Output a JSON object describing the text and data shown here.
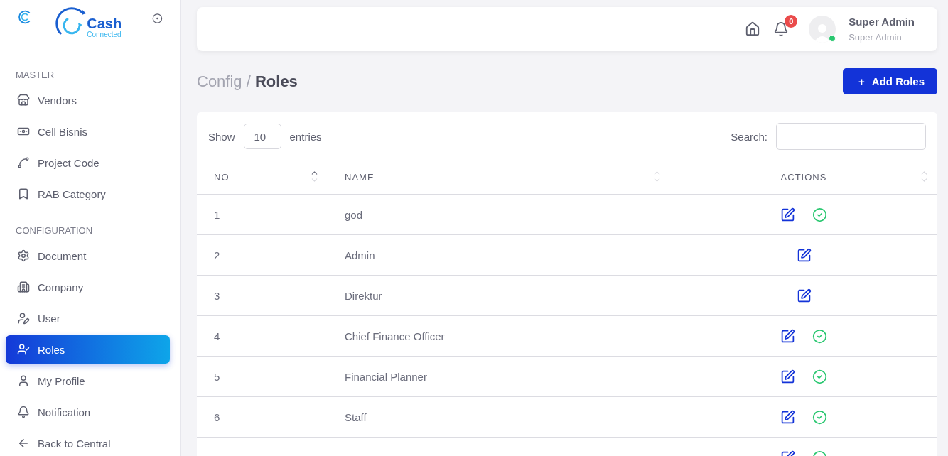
{
  "logo": {
    "word": "Cash",
    "tagline": "Connected"
  },
  "sidebar": {
    "sections": [
      {
        "title": "MASTER",
        "items": [
          {
            "label": "Vendors",
            "selected": false
          },
          {
            "label": "Cell Bisnis",
            "selected": false
          },
          {
            "label": "Project Code",
            "selected": false
          },
          {
            "label": "RAB Category",
            "selected": false
          }
        ]
      },
      {
        "title": "CONFIGURATION",
        "items": [
          {
            "label": "Document",
            "selected": false
          },
          {
            "label": "Company",
            "selected": false
          },
          {
            "label": "User",
            "selected": false
          },
          {
            "label": "Roles",
            "selected": true
          },
          {
            "label": "My Profile",
            "selected": false
          },
          {
            "label": "Notification",
            "selected": false
          },
          {
            "label": "Back to Central",
            "selected": false
          }
        ]
      }
    ]
  },
  "header": {
    "notification_count": "0",
    "user": {
      "name": "Super Admin",
      "role": "Super Admin",
      "online": true
    }
  },
  "breadcrumb": {
    "parent": "Config / ",
    "current": "Roles"
  },
  "add_button": {
    "icon": "+",
    "label": "Add Roles"
  },
  "table": {
    "show_label": "Show",
    "page_size": "10",
    "entries_label": "entries",
    "search_label": "Search:",
    "columns": [
      {
        "label": "NO",
        "sorted": true
      },
      {
        "label": "NAME",
        "sorted": false
      },
      {
        "label": "ACTIONS",
        "sorted": false
      }
    ],
    "rows": [
      {
        "no": "1",
        "name": "god",
        "approvable": true
      },
      {
        "no": "2",
        "name": "Admin",
        "approvable": false
      },
      {
        "no": "3",
        "name": "Direktur",
        "approvable": false
      },
      {
        "no": "4",
        "name": "Chief Finance Officer",
        "approvable": true
      },
      {
        "no": "5",
        "name": "Financial Planner",
        "approvable": true
      },
      {
        "no": "6",
        "name": "Staff",
        "approvable": true
      },
      {
        "approvable": true
      }
    ]
  }
}
